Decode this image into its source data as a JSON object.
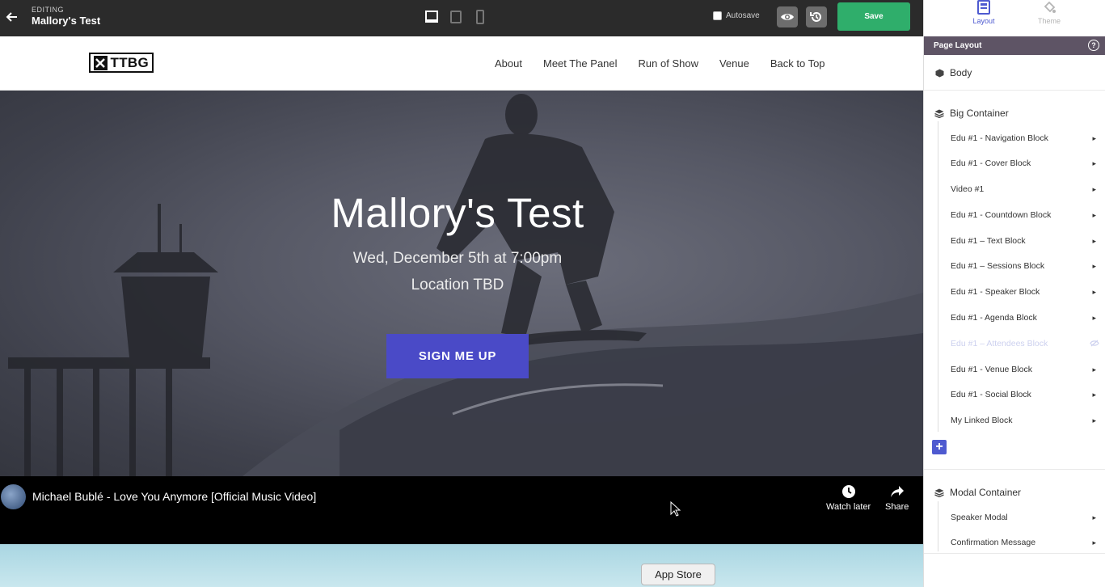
{
  "editor": {
    "editing_label": "EDITING",
    "page_name": "Mallory's Test",
    "autosave_label": "Autosave",
    "save_label": "Save"
  },
  "site": {
    "logo_text": "TTBG",
    "nav": [
      "About",
      "Meet The Panel",
      "Run of Show",
      "Venue",
      "Back to Top"
    ],
    "hero": {
      "title": "Mallory's Test",
      "date": "Wed, December 5th at 7:00pm",
      "location": "Location TBD",
      "cta": "SIGN ME UP"
    },
    "video": {
      "title": "Michael Bublé - Love You Anymore [Official Music Video]",
      "watch_later": "Watch later",
      "share": "Share"
    },
    "app_store_label": "App Store"
  },
  "panel": {
    "tabs": [
      "Layout",
      "Theme"
    ],
    "header": "Page Layout",
    "help": "?",
    "body_label": "Body",
    "big_container": {
      "label": "Big Container",
      "items": [
        {
          "label": "Edu #1 - Navigation Block",
          "hidden": false
        },
        {
          "label": "Edu #1 - Cover Block",
          "hidden": false
        },
        {
          "label": "Video #1",
          "hidden": false
        },
        {
          "label": "Edu #1 - Countdown Block",
          "hidden": false
        },
        {
          "label": "Edu #1 – Text Block",
          "hidden": false
        },
        {
          "label": "Edu #1 – Sessions Block",
          "hidden": false
        },
        {
          "label": "Edu #1 - Speaker Block",
          "hidden": false
        },
        {
          "label": "Edu #1 - Agenda Block",
          "hidden": false
        },
        {
          "label": "Edu #1 – Attendees Block",
          "hidden": true
        },
        {
          "label": "Edu #1 - Venue Block",
          "hidden": false
        },
        {
          "label": "Edu #1 - Social Block",
          "hidden": false
        },
        {
          "label": "My Linked Block",
          "hidden": false
        }
      ]
    },
    "modal_container": {
      "label": "Modal Container",
      "items": [
        {
          "label": "Speaker Modal",
          "hidden": false
        },
        {
          "label": "Confirmation Message",
          "hidden": false
        }
      ]
    }
  },
  "colors": {
    "accent": "#4e5ad0",
    "save_green": "#2fae6b",
    "panel_header": "#5e5465",
    "cta": "#4a4ac7"
  }
}
